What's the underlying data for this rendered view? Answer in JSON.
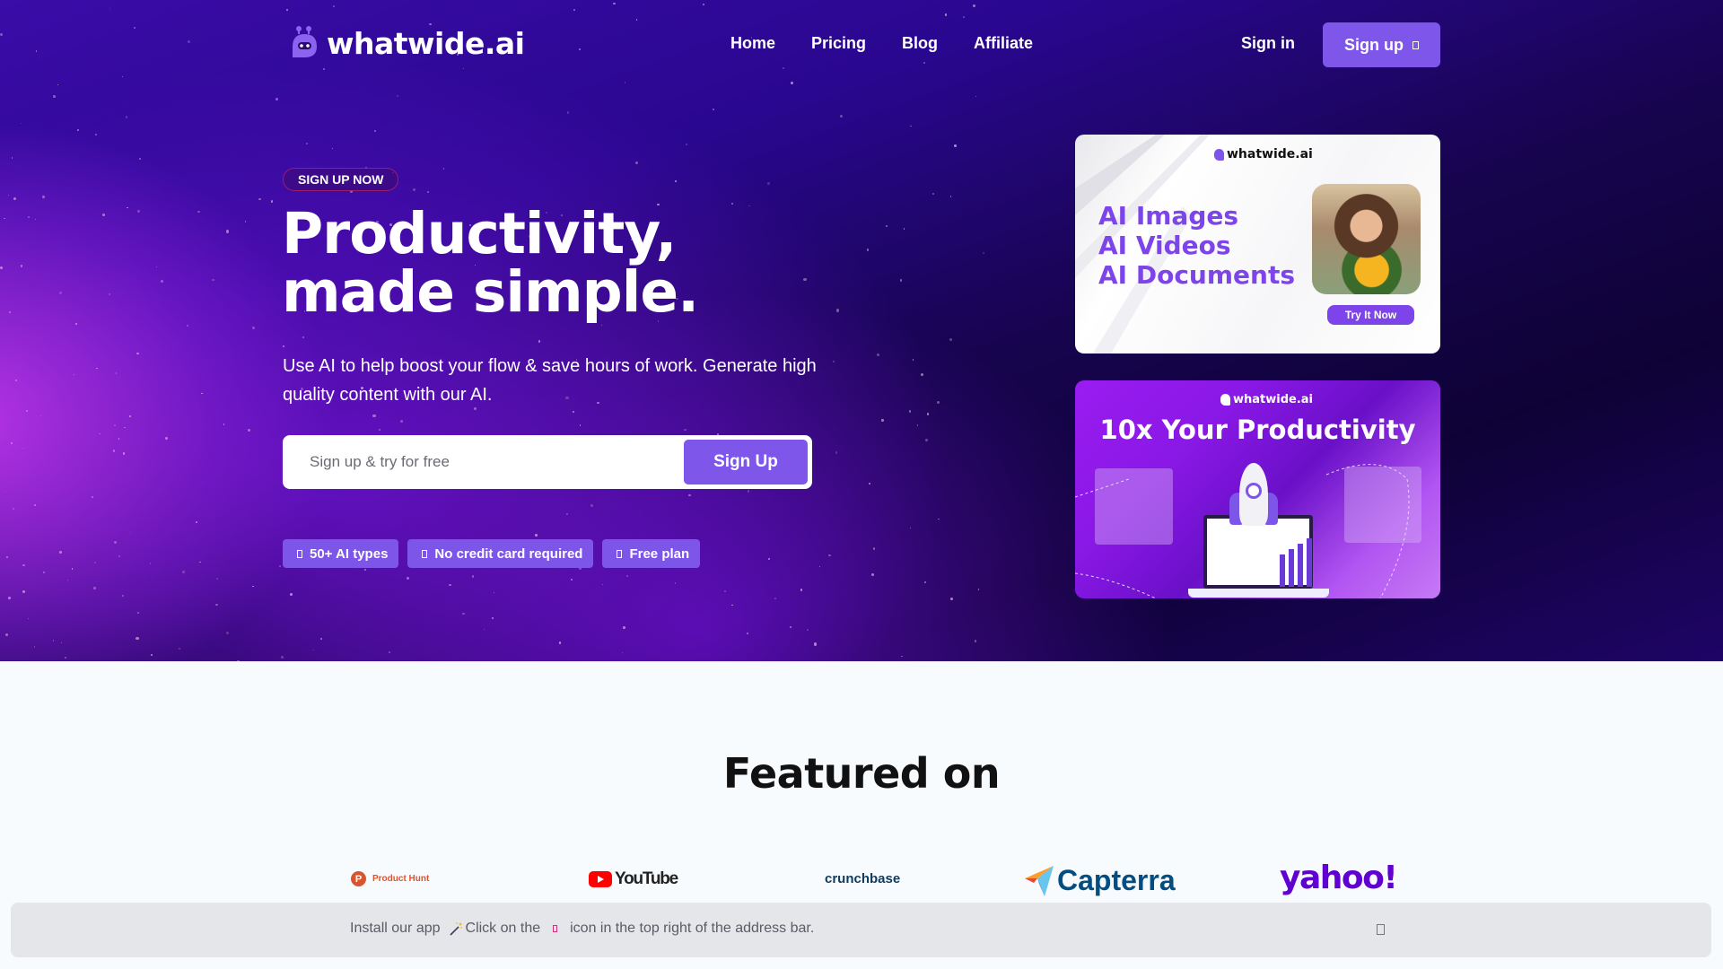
{
  "brand": {
    "name": "whatwide.ai",
    "accent": "#7f56ea"
  },
  "nav": {
    "links": [
      {
        "label": "Home"
      },
      {
        "label": "Pricing"
      },
      {
        "label": "Blog"
      },
      {
        "label": "Affiliate"
      }
    ],
    "sign_in": "Sign in",
    "sign_up": "Sign up"
  },
  "hero": {
    "badge": "SIGN UP NOW",
    "headline_line1": "Productivity,",
    "headline_line2": "made simple.",
    "subtitle": "Use AI to help boost your flow & save hours of work. Generate high quality content with our AI.",
    "input_placeholder": "Sign up & try for free",
    "input_value": "",
    "submit_label": "Sign Up",
    "chips": [
      {
        "label": "50+ AI types"
      },
      {
        "label": "No credit card required"
      },
      {
        "label": "Free plan"
      }
    ]
  },
  "promo_cards": [
    {
      "logo": "whatwide.ai",
      "lines": [
        "AI Images",
        "AI Videos",
        "AI Documents"
      ],
      "cta": "Try It Now"
    },
    {
      "logo": "whatwide.ai",
      "title": "10x Your Productivity"
    }
  ],
  "featured": {
    "title": "Featured on",
    "logos": [
      {
        "name": "Product Hunt",
        "mark": "P",
        "color": "#da552f"
      },
      {
        "name": "YouTube",
        "color": "#ff0000"
      },
      {
        "name": "crunchbase",
        "color": "#0e3a5c"
      },
      {
        "name": "Capterra",
        "color": "#044d80"
      },
      {
        "name": "yahoo!",
        "color": "#6001d2"
      }
    ]
  },
  "install_bar": {
    "prefix": "Install our app",
    "middle": "Click on the",
    "suffix": "icon in the top right of the address bar."
  }
}
